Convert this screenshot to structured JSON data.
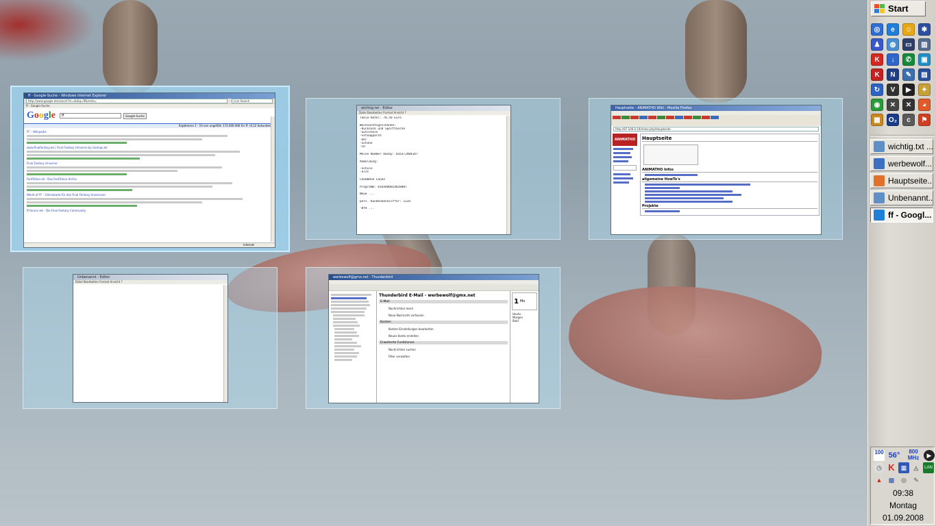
{
  "desktop": {
    "windows": [
      {
        "title": "ff - Google-Suche - Windows Internet Explorer",
        "address": "http://www.google.de/search?hl=de&q=ff&meta=",
        "search_box": "Live Search",
        "tab_label": "ff - Google-Suche",
        "google_query": "ff",
        "search_button": "Google-Suche",
        "result_header": "Ergebnisse 1 - 10 von ungefähr 172.000.000 für ff. (0,22 Sekunden)",
        "results": [
          "FF – Wikipedia",
          "www.finalfantasy.de | Final Fantasy Universe by Gamigo.de",
          "Final Fantasy Universe",
          "FanFiktion.de - Das FanFiktion Archiv",
          "World of FF - Onlinekarte für das Final Fantasy Universum",
          "ff-forum.net - Die Final Fantasy Community"
        ],
        "status": "Internet"
      },
      {
        "title": "wichtig.txt - Editor",
        "menu": "Datei  Bearbeiten  Format  Ansicht  ?",
        "lines": [
          "Tokio-Hotel: 78,50 Euro",
          "",
          "Weihnachtsgeschenke:",
          "-Rucksack und Sporttasche",
          "-Gutschein",
          "-Fotoapparat",
          "-Uhr",
          "-Schuhe",
          "-CD",
          "",
          "Meine Nummer Handy: 0163/2904347",
          "",
          "Anmeldung:",
          "",
          "-Schule",
          "-Arzt",
          "",
          "CASHBACK Canon",
          "",
          "Programm: 0164400024028007",
          "",
          "Neue ...",
          "",
          "pers. Kundenkennziffer: 1234",
          "",
          "-Bfd ..."
        ]
      },
      {
        "title": "Hauptseite - ANIMATHO Wiki - Mozilla Firefox",
        "address": "http://87.106.0.19/index.php/Hauptseite",
        "heading": "Hauptseite",
        "logo": "ANIMATHO",
        "section1": "ANIMATHO Infos",
        "section2": "allgemeine HowTo's",
        "section3": "Projekte"
      },
      {
        "title": "Unbenannt - Editor",
        "menu": "Datei  Bearbeiten  Format  Ansicht  ?"
      },
      {
        "title": "werbewolf@gmx.net - Thunderbird",
        "header": "Thunderbird E-Mail - werbewolf@gmx.net",
        "section_mail": "E-Mail",
        "item_read": "Nachrichten lesen",
        "item_write": "Neue Nachricht verfassen",
        "section_accounts": "Konten",
        "item_account_settings": "Konten-Einstellungen bearbeiten",
        "item_new_account": "Neues Konto erstellen",
        "section_advanced": "Erweiterte Funktionen",
        "item_search": "Nachrichten suchen",
        "item_filter": "Filter verwalten",
        "calendar_day": "1",
        "calendar_month": "Mo",
        "calendar_rows": [
          "Heute",
          "Morgen",
          "Bald"
        ]
      }
    ]
  },
  "sidebar": {
    "start_label": "Start",
    "quicklaunch": [
      {
        "icon": "control-panel-icon",
        "glyph": "◎",
        "color": "#2f6fd1"
      },
      {
        "icon": "internet-explorer-icon",
        "glyph": "e",
        "color": "#1f7fd9"
      },
      {
        "icon": "messenger-icon",
        "glyph": "☺",
        "color": "#e7a818"
      },
      {
        "icon": "network-icon",
        "glyph": "✱",
        "color": "#2d4fa0"
      },
      {
        "icon": "people-icon",
        "glyph": "♟",
        "color": "#3859c7"
      },
      {
        "icon": "globe-icon",
        "glyph": "◍",
        "color": "#4a8fd4"
      },
      {
        "icon": "window-icon",
        "glyph": "▭",
        "color": "#2c3e6a"
      },
      {
        "icon": "archive-icon",
        "glyph": "▥",
        "color": "#556c8f"
      },
      {
        "icon": "kaspersky-icon",
        "glyph": "K",
        "color": "#d22a22"
      },
      {
        "icon": "download-icon",
        "glyph": "↓",
        "color": "#2f66c9"
      },
      {
        "icon": "phone-icon",
        "glyph": "✆",
        "color": "#148a3a"
      },
      {
        "icon": "device-icon",
        "glyph": "▣",
        "color": "#1f8fc9"
      },
      {
        "icon": "kerio-icon",
        "glyph": "K",
        "color": "#c22222"
      },
      {
        "icon": "nero-icon",
        "glyph": "N",
        "color": "#1e3f86"
      },
      {
        "icon": "tools-icon",
        "glyph": "✎",
        "color": "#3a6fb0"
      },
      {
        "icon": "save-disk-icon",
        "glyph": "▤",
        "color": "#2a4f9a"
      },
      {
        "icon": "sync-icon",
        "glyph": "↻",
        "color": "#2d63c4"
      },
      {
        "icon": "vnc-icon",
        "glyph": "V",
        "color": "#333333"
      },
      {
        "icon": "play-icon",
        "glyph": "▶",
        "color": "#202020"
      },
      {
        "icon": "toolbox-icon",
        "glyph": "✦",
        "color": "#c8a038"
      },
      {
        "icon": "eye-icon",
        "glyph": "◉",
        "color": "#2a9a3a"
      },
      {
        "icon": "cross-tool-icon",
        "glyph": "✕",
        "color": "#444444"
      },
      {
        "icon": "cross-tool-2-icon",
        "glyph": "✕",
        "color": "#333333"
      },
      {
        "icon": "chrome-ball-icon",
        "glyph": "◕",
        "color": "#e05a2a"
      },
      {
        "icon": "grid-app-icon",
        "glyph": "▦",
        "color": "#c88a20"
      },
      {
        "icon": "o2-icon",
        "glyph": "O₂",
        "color": "#1a3c88"
      },
      {
        "icon": "conn-icon",
        "glyph": "c",
        "color": "#5a5a5a"
      },
      {
        "icon": "flag-icon",
        "glyph": "⚑",
        "color": "#d04020"
      }
    ],
    "tasks": [
      {
        "label": "wichtig.txt ...",
        "icon": "notepad-icon",
        "active": false
      },
      {
        "label": "werbewolf...",
        "icon": "thunderbird-icon",
        "active": false
      },
      {
        "label": "Hauptseite...",
        "icon": "firefox-icon",
        "active": false
      },
      {
        "label": "Unbenannt...",
        "icon": "notepad-icon",
        "active": false
      },
      {
        "label": "ff - Googl...",
        "icon": "internet-explorer-icon",
        "active": true
      }
    ],
    "tray": {
      "cpu_value": "100",
      "temperature": "56°",
      "mhz_value": "800",
      "mhz_unit": "MHz",
      "lan_label": "LAN",
      "time": "09:38",
      "weekday": "Montag",
      "date": "01.09.2008"
    }
  }
}
